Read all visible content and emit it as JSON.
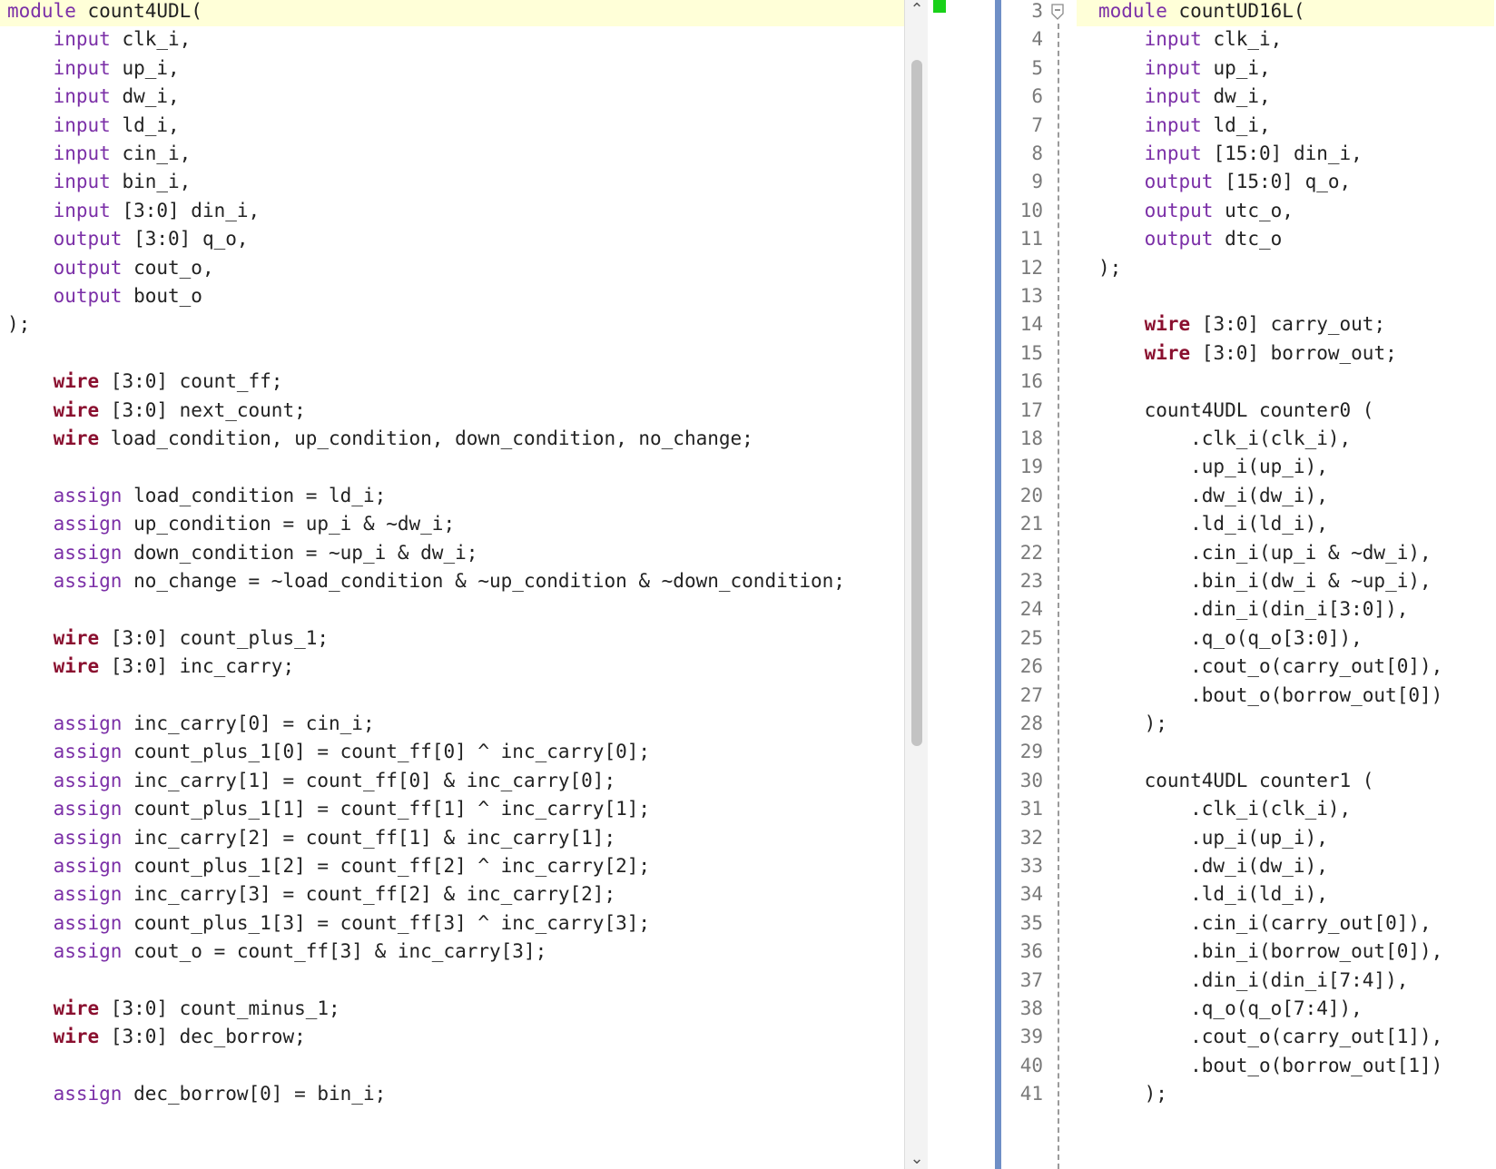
{
  "left_editor": {
    "lines": [
      [
        {
          "t": "module",
          "c": "kw"
        },
        {
          "t": " count4UDL(",
          "c": "pl"
        }
      ],
      [
        {
          "t": "    ",
          "c": "pl"
        },
        {
          "t": "input",
          "c": "kw"
        },
        {
          "t": " clk_i,",
          "c": "pl"
        }
      ],
      [
        {
          "t": "    ",
          "c": "pl"
        },
        {
          "t": "input",
          "c": "kw"
        },
        {
          "t": " up_i,",
          "c": "pl"
        }
      ],
      [
        {
          "t": "    ",
          "c": "pl"
        },
        {
          "t": "input",
          "c": "kw"
        },
        {
          "t": " dw_i,",
          "c": "pl"
        }
      ],
      [
        {
          "t": "    ",
          "c": "pl"
        },
        {
          "t": "input",
          "c": "kw"
        },
        {
          "t": " ld_i,",
          "c": "pl"
        }
      ],
      [
        {
          "t": "    ",
          "c": "pl"
        },
        {
          "t": "input",
          "c": "kw"
        },
        {
          "t": " cin_i,",
          "c": "pl"
        }
      ],
      [
        {
          "t": "    ",
          "c": "pl"
        },
        {
          "t": "input",
          "c": "kw"
        },
        {
          "t": " bin_i,",
          "c": "pl"
        }
      ],
      [
        {
          "t": "    ",
          "c": "pl"
        },
        {
          "t": "input",
          "c": "kw"
        },
        {
          "t": " [3:0] din_i,",
          "c": "pl"
        }
      ],
      [
        {
          "t": "    ",
          "c": "pl"
        },
        {
          "t": "output",
          "c": "kw"
        },
        {
          "t": " [3:0] q_o,",
          "c": "pl"
        }
      ],
      [
        {
          "t": "    ",
          "c": "pl"
        },
        {
          "t": "output",
          "c": "kw"
        },
        {
          "t": " cout_o,",
          "c": "pl"
        }
      ],
      [
        {
          "t": "    ",
          "c": "pl"
        },
        {
          "t": "output",
          "c": "kw"
        },
        {
          "t": " bout_o",
          "c": "pl"
        }
      ],
      [
        {
          "t": ");",
          "c": "pl"
        }
      ],
      [],
      [
        {
          "t": "    ",
          "c": "pl"
        },
        {
          "t": "wire",
          "c": "kb"
        },
        {
          "t": " [3:0] count_ff;",
          "c": "pl"
        }
      ],
      [
        {
          "t": "    ",
          "c": "pl"
        },
        {
          "t": "wire",
          "c": "kb"
        },
        {
          "t": " [3:0] next_count;",
          "c": "pl"
        }
      ],
      [
        {
          "t": "    ",
          "c": "pl"
        },
        {
          "t": "wire",
          "c": "kb"
        },
        {
          "t": " load_condition, up_condition, down_condition, no_change;",
          "c": "pl"
        }
      ],
      [],
      [
        {
          "t": "    ",
          "c": "pl"
        },
        {
          "t": "assign",
          "c": "kw"
        },
        {
          "t": " load_condition = ld_i;",
          "c": "pl"
        }
      ],
      [
        {
          "t": "    ",
          "c": "pl"
        },
        {
          "t": "assign",
          "c": "kw"
        },
        {
          "t": " up_condition = up_i & ~dw_i;",
          "c": "pl"
        }
      ],
      [
        {
          "t": "    ",
          "c": "pl"
        },
        {
          "t": "assign",
          "c": "kw"
        },
        {
          "t": " down_condition = ~up_i & dw_i;",
          "c": "pl"
        }
      ],
      [
        {
          "t": "    ",
          "c": "pl"
        },
        {
          "t": "assign",
          "c": "kw"
        },
        {
          "t": " no_change = ~load_condition & ~up_condition & ~down_condition;",
          "c": "pl"
        }
      ],
      [],
      [
        {
          "t": "    ",
          "c": "pl"
        },
        {
          "t": "wire",
          "c": "kb"
        },
        {
          "t": " [3:0] count_plus_1;",
          "c": "pl"
        }
      ],
      [
        {
          "t": "    ",
          "c": "pl"
        },
        {
          "t": "wire",
          "c": "kb"
        },
        {
          "t": " [3:0] inc_carry;",
          "c": "pl"
        }
      ],
      [],
      [
        {
          "t": "    ",
          "c": "pl"
        },
        {
          "t": "assign",
          "c": "kw"
        },
        {
          "t": " inc_carry[0] = cin_i;",
          "c": "pl"
        }
      ],
      [
        {
          "t": "    ",
          "c": "pl"
        },
        {
          "t": "assign",
          "c": "kw"
        },
        {
          "t": " count_plus_1[0] = count_ff[0] ^ inc_carry[0];",
          "c": "pl"
        }
      ],
      [
        {
          "t": "    ",
          "c": "pl"
        },
        {
          "t": "assign",
          "c": "kw"
        },
        {
          "t": " inc_carry[1] = count_ff[0] & inc_carry[0];",
          "c": "pl"
        }
      ],
      [
        {
          "t": "    ",
          "c": "pl"
        },
        {
          "t": "assign",
          "c": "kw"
        },
        {
          "t": " count_plus_1[1] = count_ff[1] ^ inc_carry[1];",
          "c": "pl"
        }
      ],
      [
        {
          "t": "    ",
          "c": "pl"
        },
        {
          "t": "assign",
          "c": "kw"
        },
        {
          "t": " inc_carry[2] = count_ff[1] & inc_carry[1];",
          "c": "pl"
        }
      ],
      [
        {
          "t": "    ",
          "c": "pl"
        },
        {
          "t": "assign",
          "c": "kw"
        },
        {
          "t": " count_plus_1[2] = count_ff[2] ^ inc_carry[2];",
          "c": "pl"
        }
      ],
      [
        {
          "t": "    ",
          "c": "pl"
        },
        {
          "t": "assign",
          "c": "kw"
        },
        {
          "t": " inc_carry[3] = count_ff[2] & inc_carry[2];",
          "c": "pl"
        }
      ],
      [
        {
          "t": "    ",
          "c": "pl"
        },
        {
          "t": "assign",
          "c": "kw"
        },
        {
          "t": " count_plus_1[3] = count_ff[3] ^ inc_carry[3];",
          "c": "pl"
        }
      ],
      [
        {
          "t": "    ",
          "c": "pl"
        },
        {
          "t": "assign",
          "c": "kw"
        },
        {
          "t": " cout_o = count_ff[3] & inc_carry[3];",
          "c": "pl"
        }
      ],
      [],
      [
        {
          "t": "    ",
          "c": "pl"
        },
        {
          "t": "wire",
          "c": "kb"
        },
        {
          "t": " [3:0] count_minus_1;",
          "c": "pl"
        }
      ],
      [
        {
          "t": "    ",
          "c": "pl"
        },
        {
          "t": "wire",
          "c": "kb"
        },
        {
          "t": " [3:0] dec_borrow;",
          "c": "pl"
        }
      ],
      [],
      [
        {
          "t": "    ",
          "c": "pl"
        },
        {
          "t": "assign",
          "c": "kw"
        },
        {
          "t": " dec_borrow[0] = bin_i;",
          "c": "pl"
        }
      ]
    ]
  },
  "scrollbar": {
    "up_arrow": "⌃",
    "down_arrow": "⌄"
  },
  "right_editor": {
    "line_numbers": [
      "3",
      "4",
      "5",
      "6",
      "7",
      "8",
      "9",
      "10",
      "11",
      "12",
      "13",
      "14",
      "15",
      "16",
      "17",
      "18",
      "19",
      "20",
      "21",
      "22",
      "23",
      "24",
      "25",
      "26",
      "27",
      "28",
      "29",
      "30",
      "31",
      "32",
      "33",
      "34",
      "35",
      "36",
      "37",
      "38",
      "39",
      "40",
      "41"
    ],
    "lines": [
      [
        {
          "t": "module",
          "c": "kw"
        },
        {
          "t": " countUD16L(",
          "c": "pl"
        }
      ],
      [
        {
          "t": "    ",
          "c": "pl"
        },
        {
          "t": "input",
          "c": "kw"
        },
        {
          "t": " clk_i,",
          "c": "pl"
        }
      ],
      [
        {
          "t": "    ",
          "c": "pl"
        },
        {
          "t": "input",
          "c": "kw"
        },
        {
          "t": " up_i,",
          "c": "pl"
        }
      ],
      [
        {
          "t": "    ",
          "c": "pl"
        },
        {
          "t": "input",
          "c": "kw"
        },
        {
          "t": " dw_i,",
          "c": "pl"
        }
      ],
      [
        {
          "t": "    ",
          "c": "pl"
        },
        {
          "t": "input",
          "c": "kw"
        },
        {
          "t": " ld_i,",
          "c": "pl"
        }
      ],
      [
        {
          "t": "    ",
          "c": "pl"
        },
        {
          "t": "input",
          "c": "kw"
        },
        {
          "t": " [15:0] din_i,",
          "c": "pl"
        }
      ],
      [
        {
          "t": "    ",
          "c": "pl"
        },
        {
          "t": "output",
          "c": "kw"
        },
        {
          "t": " [15:0] q_o,",
          "c": "pl"
        }
      ],
      [
        {
          "t": "    ",
          "c": "pl"
        },
        {
          "t": "output",
          "c": "kw"
        },
        {
          "t": " utc_o,",
          "c": "pl"
        }
      ],
      [
        {
          "t": "    ",
          "c": "pl"
        },
        {
          "t": "output",
          "c": "kw"
        },
        {
          "t": " dtc_o",
          "c": "pl"
        }
      ],
      [
        {
          "t": ");",
          "c": "pl"
        }
      ],
      [],
      [
        {
          "t": "    ",
          "c": "pl"
        },
        {
          "t": "wire",
          "c": "kb"
        },
        {
          "t": " [3:0] carry_out;",
          "c": "pl"
        }
      ],
      [
        {
          "t": "    ",
          "c": "pl"
        },
        {
          "t": "wire",
          "c": "kb"
        },
        {
          "t": " [3:0] borrow_out;",
          "c": "pl"
        }
      ],
      [],
      [
        {
          "t": "    count4UDL counter0 (",
          "c": "pl"
        }
      ],
      [
        {
          "t": "        .clk_i(clk_i),",
          "c": "pl"
        }
      ],
      [
        {
          "t": "        .up_i(up_i),",
          "c": "pl"
        }
      ],
      [
        {
          "t": "        .dw_i(dw_i),",
          "c": "pl"
        }
      ],
      [
        {
          "t": "        .ld_i(ld_i),",
          "c": "pl"
        }
      ],
      [
        {
          "t": "        .cin_i(up_i & ~dw_i),",
          "c": "pl"
        }
      ],
      [
        {
          "t": "        .bin_i(dw_i & ~up_i),",
          "c": "pl"
        }
      ],
      [
        {
          "t": "        .din_i(din_i[3:0]),",
          "c": "pl"
        }
      ],
      [
        {
          "t": "        .q_o(q_o[3:0]),",
          "c": "pl"
        }
      ],
      [
        {
          "t": "        .cout_o(carry_out[0]),",
          "c": "pl"
        }
      ],
      [
        {
          "t": "        .bout_o(borrow_out[0])",
          "c": "pl"
        }
      ],
      [
        {
          "t": "    );",
          "c": "pl"
        }
      ],
      [],
      [
        {
          "t": "    count4UDL counter1 (",
          "c": "pl"
        }
      ],
      [
        {
          "t": "        .clk_i(clk_i),",
          "c": "pl"
        }
      ],
      [
        {
          "t": "        .up_i(up_i),",
          "c": "pl"
        }
      ],
      [
        {
          "t": "        .dw_i(dw_i),",
          "c": "pl"
        }
      ],
      [
        {
          "t": "        .ld_i(ld_i),",
          "c": "pl"
        }
      ],
      [
        {
          "t": "        .cin_i(carry_out[0]),",
          "c": "pl"
        }
      ],
      [
        {
          "t": "        .bin_i(borrow_out[0]),",
          "c": "pl"
        }
      ],
      [
        {
          "t": "        .din_i(din_i[7:4]),",
          "c": "pl"
        }
      ],
      [
        {
          "t": "        .q_o(q_o[7:4]),",
          "c": "pl"
        }
      ],
      [
        {
          "t": "        .cout_o(carry_out[1]),",
          "c": "pl"
        }
      ],
      [
        {
          "t": "        .bout_o(borrow_out[1])",
          "c": "pl"
        }
      ],
      [
        {
          "t": "    );",
          "c": "pl"
        }
      ]
    ]
  }
}
